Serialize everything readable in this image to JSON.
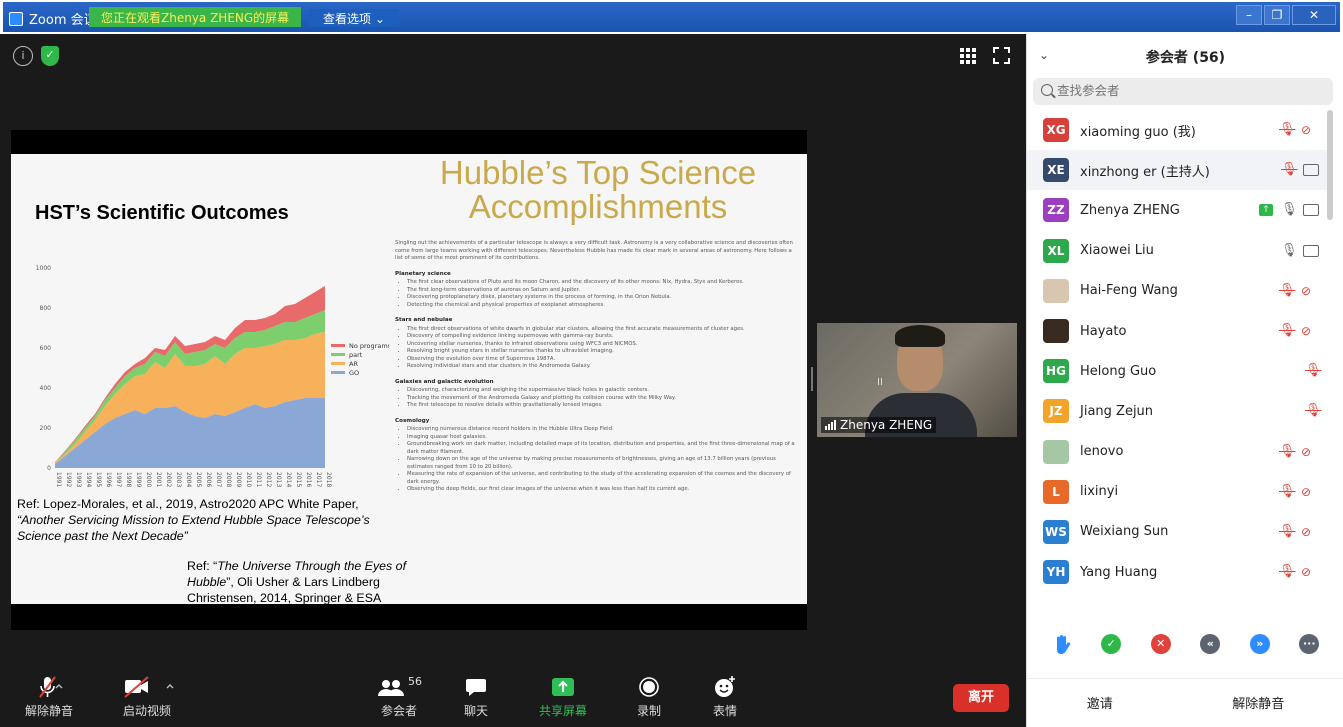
{
  "window": {
    "app_title": "Zoom 会议",
    "viewing_banner": "您正在观看Zhenya  ZHENG的屏幕",
    "view_options": "查看选项"
  },
  "slide": {
    "left_title": "HST’s Scientific Outcomes",
    "chart_data": {
      "type": "area",
      "x": [
        "1991",
        "1992",
        "1993",
        "1994",
        "1995",
        "1996",
        "1997",
        "1998",
        "1999",
        "2000",
        "2001",
        "2002",
        "2003",
        "2004",
        "2005",
        "2006",
        "2007",
        "2008",
        "2009",
        "2010",
        "2011",
        "2012",
        "2013",
        "2014",
        "2015",
        "2016",
        "2017",
        "2018"
      ],
      "ylim": [
        0,
        1000
      ],
      "yticks": [
        "0",
        "200",
        "400",
        "600",
        "800",
        "1000"
      ],
      "legend": [
        "No programs",
        "part",
        "AR",
        "GO"
      ],
      "legend_position": "right",
      "colors": {
        "No programs": "#e86a6a",
        "part": "#7dcf6e",
        "AR": "#f7b15a",
        "GO": "#8aa7d6"
      },
      "series": [
        {
          "name": "GO",
          "values": [
            20,
            60,
            100,
            140,
            180,
            220,
            250,
            270,
            290,
            270,
            300,
            300,
            310,
            280,
            260,
            250,
            270,
            260,
            280,
            300,
            320,
            300,
            310,
            330,
            340,
            350,
            350,
            350
          ]
        },
        {
          "name": "AR",
          "values": [
            5,
            10,
            20,
            40,
            60,
            90,
            120,
            150,
            170,
            200,
            230,
            200,
            260,
            230,
            250,
            270,
            290,
            260,
            290,
            300,
            280,
            310,
            310,
            310,
            300,
            300,
            320,
            330
          ]
        },
        {
          "name": "part",
          "values": [
            5,
            10,
            20,
            20,
            20,
            30,
            30,
            40,
            40,
            50,
            50,
            60,
            60,
            60,
            70,
            70,
            60,
            80,
            80,
            80,
            80,
            80,
            90,
            90,
            90,
            100,
            100,
            110
          ]
        },
        {
          "name": "No programs",
          "values": [
            0,
            5,
            5,
            10,
            10,
            10,
            20,
            20,
            20,
            30,
            20,
            30,
            30,
            40,
            40,
            40,
            40,
            40,
            50,
            60,
            60,
            60,
            60,
            80,
            90,
            100,
            110,
            120
          ]
        }
      ]
    },
    "ref1_line1": "Ref: Lopez-Morales, et al., 2019, Astro2020 APC White Paper,",
    "ref1_italic": "“Another Servicing Mission to Extend Hubble Space Telescope’s Science past the Next Decade”",
    "ref2_prefix": "Ref: “",
    "ref2_italic": "The Universe Through the Eyes of Hubble",
    "ref2_suffix": "”, Oli Usher & Lars Lindberg Christensen, 2014, Springer & ESA",
    "hub_title_line1": "Hubble’s Top Science",
    "hub_title_line2": "Accomplishments",
    "hub_intro": "Singling out the achievements of a particular telescope is always a very difficult task. Astronomy is a very collaborative science and discoveries often come from large teams working with different telescopes. Nevertheless Hubble has made its clear mark in several areas of astronomy. Here follows a list of some of the most prominent of its contributions.",
    "sections": [
      {
        "heading": "Planetary science",
        "items": [
          "The first clear observations of Pluto and its moon Charon, and the discovery of its other moons: Nix, Hydra, Styx and Kerberos.",
          "The first long-term observations of auroras on Saturn and Jupiter.",
          "Discovering protoplanetary disks, planetary systems in the process of forming, in the Orion Nebula.",
          "Detecting the chemical and physical properties of exoplanet atmospheres."
        ]
      },
      {
        "heading": "Stars and nebulae",
        "items": [
          "The first direct observations of white dwarfs in globular star clusters, allowing the first accurate measurements of cluster ages.",
          "Discovery of compelling evidence linking supernovae with gamma-ray bursts.",
          "Uncovering stellar nurseries, thanks to infrared observations using WFC3 and NICMOS.",
          "Resolving bright young stars in stellar nurseries thanks to ultraviolet imaging.",
          "Observing the evolution over time of Supernova 1987A.",
          "Resolving individual stars and star clusters in the Andromeda Galaxy."
        ]
      },
      {
        "heading": "Galaxies and galactic evolution",
        "items": [
          "Discovering, characterizing and weighing the supermassive black holes in galactic centers.",
          "Tracking the movement of the Andromeda Galaxy and plotting its collision course with the Milky Way.",
          "The first telescope to resolve details within gravitationally lensed images."
        ]
      },
      {
        "heading": "Cosmology",
        "items": [
          "Discovering numerous distance record holders in the Hubble Ultra Deep Field.",
          "Imaging quasar host galaxies.",
          "Groundbreaking work on dark matter, including detailed maps of its location, distribution and properties, and the first three-dimensional map of a dark matter filament.",
          "Narrowing down on the age of the universe by making precise measurements of brightnesses, giving an age of 13.7 billion years (previous estimates ranged from 10 to 20 billion).",
          "Measuring the rate of expansion of the universe, and contributing to the study of the accelerating expansion of the cosmos and the discovery of dark energy.",
          "Observing the deep fields, our first clear images of the universe when it was less than half its current age."
        ]
      }
    ]
  },
  "video_tile": {
    "name": "Zhenya ZHENG"
  },
  "toolbar": {
    "mute": "解除静音",
    "video": "启动视频",
    "participants": "参会者",
    "participants_count": "56",
    "chat": "聊天",
    "share": "共享屏幕",
    "record": "录制",
    "reactions": "表情",
    "leave": "离开"
  },
  "panel": {
    "title": "参会者 (56)",
    "search_placeholder": "查找参会者",
    "participants": [
      {
        "initials": "XG",
        "name": "xiaoming guo (我)",
        "color": "#d7403a",
        "mic": "muted",
        "cam": "off"
      },
      {
        "initials": "XE",
        "name": "xinzhong er (主持人)",
        "color": "#34496b",
        "mic": "muted",
        "cam": "on"
      },
      {
        "initials": "ZZ",
        "name": "Zhenya ZHENG",
        "color": "#9b3ec0",
        "mic": "on",
        "cam": "on",
        "sharing": true
      },
      {
        "initials": "XL",
        "name": "Xiaowei Liu",
        "color": "#2ea84d",
        "mic": "on",
        "cam": "on"
      },
      {
        "initials": "",
        "name": "Hai-Feng Wang",
        "color": "#d9c6b0",
        "mic": "muted",
        "cam": "off",
        "photo": true
      },
      {
        "initials": "",
        "name": "Hayato",
        "color": "#3a2b20",
        "mic": "muted",
        "cam": "off",
        "photo": true
      },
      {
        "initials": "HG",
        "name": "Helong Guo",
        "color": "#2ea84d",
        "mic": "muted",
        "cam": "none"
      },
      {
        "initials": "JZ",
        "name": "Jiang Zejun",
        "color": "#f2a32a",
        "mic": "muted",
        "cam": "none"
      },
      {
        "initials": "",
        "name": "lenovo",
        "color": "#a6c7a3",
        "mic": "muted",
        "cam": "off",
        "photo": true
      },
      {
        "initials": "L",
        "name": "lixinyi",
        "color": "#e86a2a",
        "mic": "muted",
        "cam": "off"
      },
      {
        "initials": "WS",
        "name": "Weixiang Sun",
        "color": "#2a7fd1",
        "mic": "muted",
        "cam": "off"
      },
      {
        "initials": "YH",
        "name": "Yang Huang",
        "color": "#2a7fd1",
        "mic": "muted",
        "cam": "off"
      }
    ],
    "invite": "邀请",
    "unmute_all": "解除静音"
  }
}
